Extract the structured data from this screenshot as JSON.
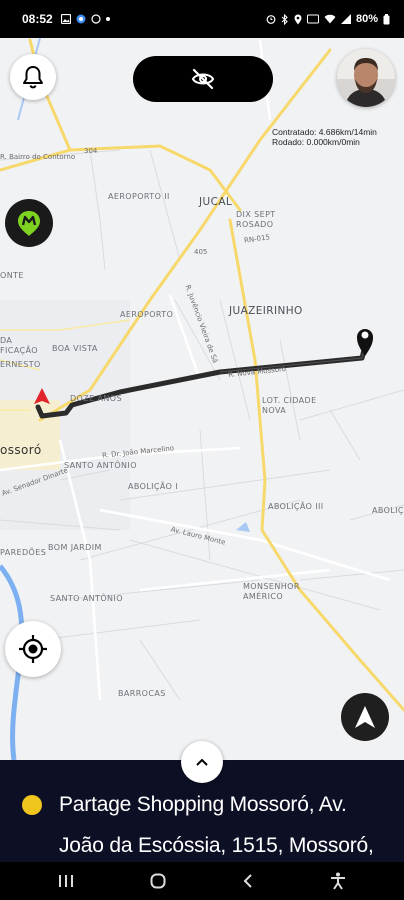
{
  "status_bar": {
    "time": "08:52",
    "left_icons": [
      "image-icon",
      "map-icon",
      "whatsapp-icon",
      "dot-icon"
    ],
    "right_icons": [
      "alarm-icon",
      "bluetooth-icon",
      "location-icon",
      "lte-icon",
      "wifi-icon",
      "signal-icon"
    ],
    "battery": "80%"
  },
  "map": {
    "labels": {
      "aeroporto_ii": "AEROPORTO II",
      "jucal": "JUCAL",
      "dix_sept_rosado": "DIX SEPT\nROSADO",
      "juazeirinho": "JUAZEIRINHO",
      "aeroporto": "AEROPORTO",
      "onte": "ONTE",
      "boa_vista": "BOA VISTA",
      "dozeanos": "DOZE ANOS",
      "lot_cidade_nova": "LOT. CIDADE\nNOVA",
      "mossoro": "ossoró",
      "santo_antonio": "SANTO ANTÔNIO",
      "abolicao_i": "ABOLIÇÃO I",
      "abolicao_iii": "ABOLIÇÃO III",
      "abolicao": "ABOLIÇ",
      "paredoes": "PAREDÕES",
      "bom_jardim": "BOM JARDIM",
      "santo_antonio_2": "SANTO ANTÔNIO",
      "monsenhor_americo": "MONSENHOR\nAMÉRICO",
      "barrocas": "BARROCAS",
      "da_ficacao": "DA\nFICAÇÃO",
      "ernesto": "ERNESTO"
    },
    "road_labels": {
      "br304": "304",
      "rn015": "RN-015",
      "r405": "405",
      "av_lauro": "Av. Lauro Monte",
      "r_joao": "R. Dr. João Marcelino",
      "r_bairro": "R. Bairro do Contorno",
      "av_senador": "Av. Senador Dinarte",
      "r_jose": "R. Juvêncio Vieira de Sá",
      "r_nova": "R. Nova Mossoró"
    },
    "contract_info": {
      "line1": "Contratado: 4.686km/14min",
      "line2": "Rodado: 0.000km/0min"
    }
  },
  "controls": {
    "bell": "bell-icon",
    "privacy": "eye-off-icon",
    "brand": "brand-logo",
    "locate": "crosshair-icon",
    "navigate": "navigation-arrow-icon",
    "expand": "chevron-up-icon"
  },
  "destination": {
    "text": "Partage Shopping Mossoró, Av. João da Escóssia, 1515, Mossoró,"
  },
  "colors": {
    "route": "#2b2b2b",
    "panel": "#0d0f25",
    "dest_dot": "#f0c51e",
    "origin_marker": "#e0242a",
    "brand": "#7ed321",
    "highway": "#f7d86b"
  }
}
